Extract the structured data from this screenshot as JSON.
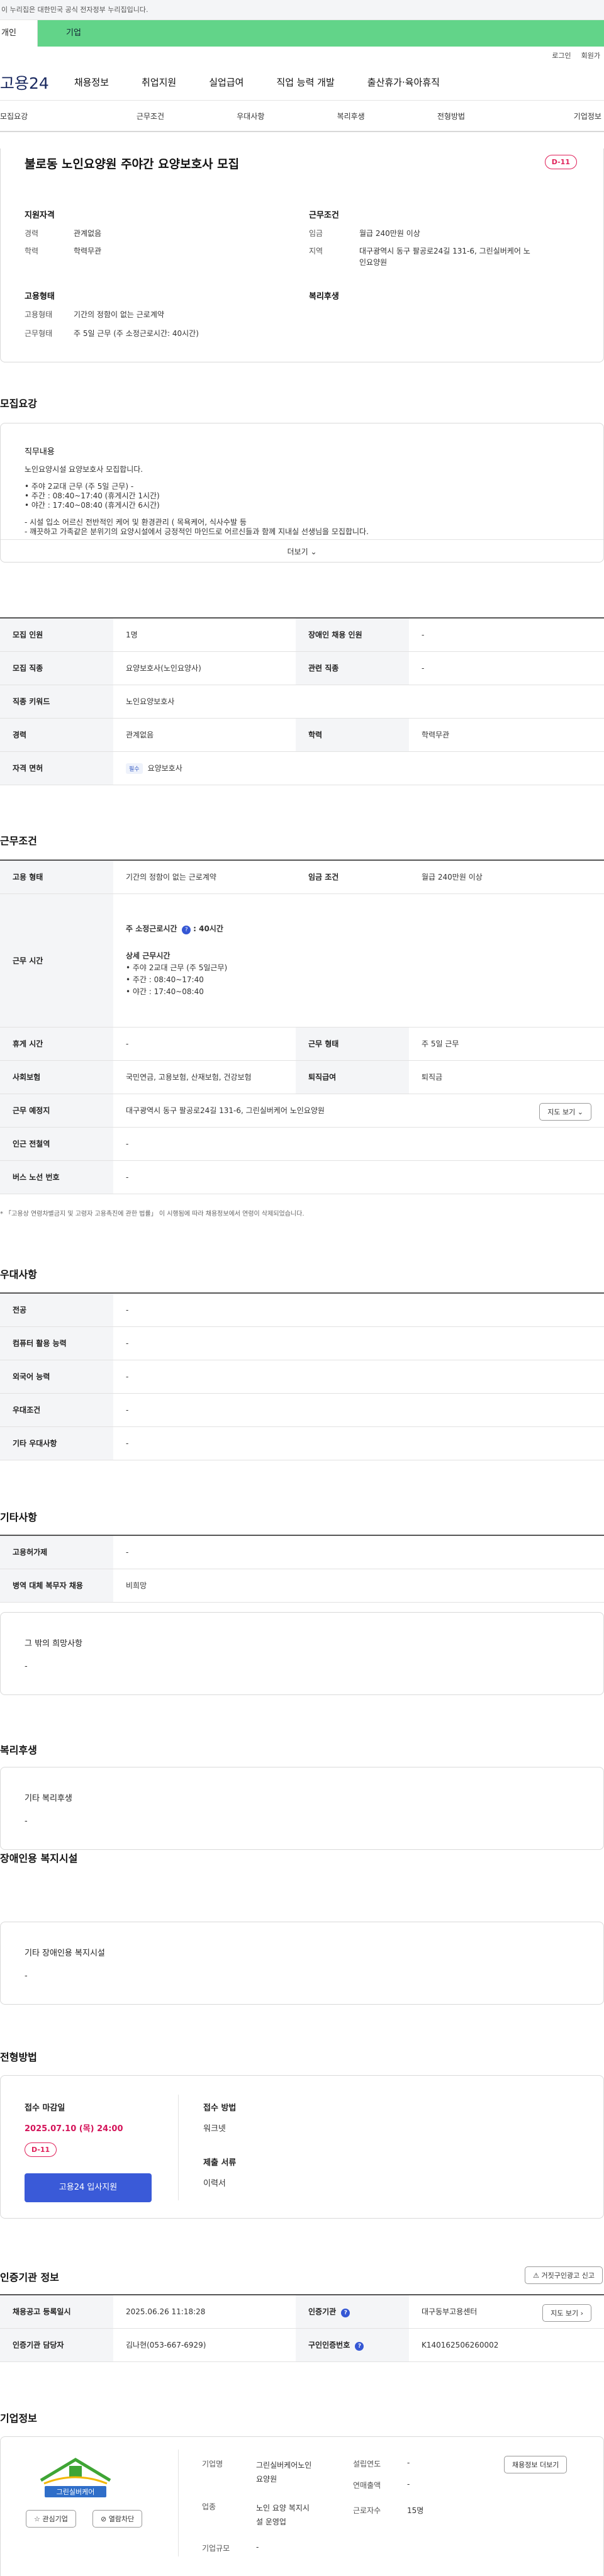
{
  "gov_banner": "이 누리집은 대한민국 공식 전자정부 누리집입니다.",
  "audience": {
    "individual": "개인",
    "corporate": "기업"
  },
  "util": {
    "login": "로그인",
    "signup": "회원가"
  },
  "gnb": {
    "logo": "고용24",
    "items": [
      "채용정보",
      "취업지원",
      "실업급여",
      "직업 능력 개발",
      "출산휴가·육아휴직"
    ]
  },
  "subnav": [
    "모집요강",
    "근무조건",
    "우대사항",
    "복리후생",
    "전형방법",
    "기업정보"
  ],
  "job": {
    "title": "불로동 노인요양원 주야간 요양보호사 모집",
    "dday": "D-11",
    "qual_label": "지원자격",
    "exp_k": "경력",
    "exp_v": "관계없음",
    "edu_k": "학력",
    "edu_v": "학력무관",
    "cond_label": "근무조건",
    "wage_k": "임금",
    "wage_v": "월급 240만원 이상",
    "area_k": "지역",
    "area_v1": "대구광역시 동구 팔공로24길 131-6, 그린실버케어 노",
    "area_v2": "인요양원",
    "emp_label": "고용형태",
    "emptype_k": "고용형태",
    "emptype_v": "기간의 정함이 없는 근로계약",
    "worktype_k": "근무형태",
    "worktype_v": "주 5일 근무 (주 소정근로시간: 40시간)",
    "welfare_label": "복리후생"
  },
  "recruit": {
    "heading": "모집요강",
    "duty_label": "직무내용",
    "lines": [
      "노인요양시설 요양보호사 모집합니다.",
      "",
      "• 주야 2교대 근무 (주 5일 근무) -",
      "• 주간 : 08:40~17:40 (휴게시간 1시간)",
      "• 야간 : 17:40~08:40 (휴게시간 6시간)",
      "",
      "- 시설 입소 어르신 전반적인 케어 및 환경관리 ( 목욕케어, 식사수발 등",
      "- 깨끗하고 가족같은 분위기의 요양시설에서 긍정적인 마인드로 어르신들과 함께 지내실 선생님을 모집합니다."
    ],
    "more": "더보기",
    "rows": [
      {
        "k1": "모집 인원",
        "v1": "1명",
        "k2": "장애인 채용 인원",
        "v2": "-"
      },
      {
        "k1": "모집 직종",
        "v1": "요양보호사(노인요양사)",
        "k2": "관련 직종",
        "v2": "-"
      },
      {
        "k1": "직종 키워드",
        "v1": "노인요양보호사"
      },
      {
        "k1": "경력",
        "v1": "관계없음",
        "k2": "학력",
        "v2": "학력무관"
      },
      {
        "k1": "자격 면허",
        "chip": "필수",
        "v1": "요양보호사"
      }
    ]
  },
  "work": {
    "heading": "근무조건",
    "emp_k": "고용 형태",
    "emp_v": "기간의 정함이 없는 근로계약",
    "wage_k": "임금 조건",
    "wage_v": "월급 240만원 이상",
    "time_k": "근무 시간",
    "time_weekly": "주 소정근로시간",
    "time_weekly_v": ": 40시간",
    "time_detail_label": "상세 근무시간",
    "time_lines": [
      "• 주야 2교대 근무 (주 5일근무)",
      "• 주간 : 08:40~17:40",
      "• 야간 : 17:40~08:40"
    ],
    "rest_k": "휴게 시간",
    "rest_v": "-",
    "form_k": "근무 형태",
    "form_v": "주 5일 근무",
    "ins_k": "사회보험",
    "ins_v": "국민연금, 고용보험, 산재보험, 건강보험",
    "ret_k": "퇴직급여",
    "ret_v": "퇴직금",
    "place_k": "근무 예정지",
    "place_v": "대구광역시 동구 팔공로24길 131-6, 그린실버케어 노인요양원",
    "map_btn": "지도 보기",
    "subway_k": "인근 전철역",
    "subway_v": "-",
    "bus_k": "버스 노선 번호",
    "bus_v": "-",
    "note": "* 「고용상 연령차별금지 및 고령자 고용촉진에 관한 법률」 이 시행됨에 따라 채용정보에서 연령이 삭제되었습니다."
  },
  "pref": {
    "heading": "우대사항",
    "rows": [
      {
        "k": "전공",
        "v": "-"
      },
      {
        "k": "컴퓨터 활용 능력",
        "v": "-"
      },
      {
        "k": "외국어 능력",
        "v": "-"
      },
      {
        "k": "우대조건",
        "v": "-"
      },
      {
        "k": "기타 우대사항",
        "v": "-"
      }
    ]
  },
  "etc": {
    "heading": "기타사항",
    "rows": [
      {
        "k": "고용허가제",
        "v": "-"
      },
      {
        "k": "병역 대체 복무자 채용",
        "v": "비희망"
      }
    ],
    "other_label": "그 밖의 희망사항",
    "other_v": "-"
  },
  "welfare": {
    "heading": "복리후생",
    "label": "기타 복리후생",
    "v": "-"
  },
  "disab": {
    "heading": "장애인용 복지시설",
    "label": "기타 장애인용 복지시설",
    "v": "-"
  },
  "proc": {
    "heading": "전형방법",
    "deadline_label": "접수 마감일",
    "deadline": "2025.07.10 (목) 24:00",
    "dday": "D-11",
    "apply_btn": "고용24 입사지원",
    "method_label": "접수 방법",
    "method_v": "워크넷",
    "docs_label": "제출 서류",
    "docs_v": "이력서"
  },
  "cert": {
    "heading": "인증기관 정보",
    "report_btn": "거짓구인광고 신고",
    "reg_k": "채용공고 등록일시",
    "reg_v": "2025.06.26 11:18:28",
    "org_k": "인증기관",
    "org_v": "대구동부고용센터",
    "map_btn": "지도 보기",
    "mgr_k": "인증기관 담당자",
    "mgr_v": "김나현(053-667-6929)",
    "auth_k": "구인인증번호",
    "auth_v": "K140162506260002"
  },
  "company": {
    "heading": "기업정보",
    "logo_text": "그린실버케어",
    "fav_btn": "관심기업",
    "block_btn": "열람차단",
    "name_k": "기업명",
    "name_v1": "그린실버케어노인",
    "name_v2": "요양원",
    "est_k": "설립연도",
    "est_v": "-",
    "sales_k": "연매출액",
    "sales_v": "-",
    "biz_k": "업종",
    "biz_v1": "노인 요양 복지시",
    "biz_v2": "설 운영업",
    "emp_k": "근로자수",
    "emp_v": "15명",
    "size_k": "기업규모",
    "size_v": "-",
    "jobs_btn": "채용정보 더보기"
  }
}
